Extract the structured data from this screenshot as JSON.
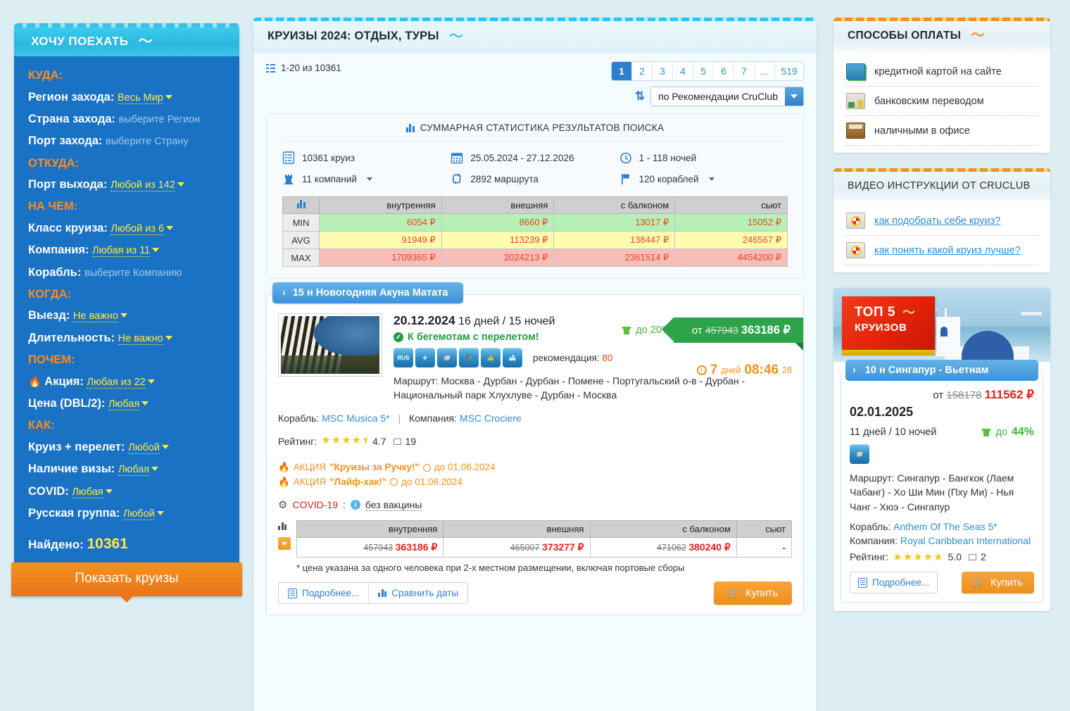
{
  "sidebar": {
    "title": "ХОЧУ ПОЕХАТЬ",
    "groups": {
      "where_to": "КУДА:",
      "where_from": "ОТКУДА:",
      "on_what": "НА ЧЕМ:",
      "when": "КОГДА:",
      "how_much": "ПОЧЕМ:",
      "how": "КАК:"
    },
    "fields": [
      {
        "label": "Регион захода:",
        "value": "Весь Мир",
        "dropdown": true
      },
      {
        "label": "Страна захода:",
        "value": "выберите Регион",
        "dropdown": false
      },
      {
        "label": "Порт захода:",
        "value": "выберите Страну",
        "dropdown": false
      },
      {
        "label": "Порт выхода:",
        "value": "Любой из 142",
        "dropdown": true
      },
      {
        "label": "Класс круиза:",
        "value": "Любой из 6",
        "dropdown": true
      },
      {
        "label": "Компания:",
        "value": "Любая из 11",
        "dropdown": true
      },
      {
        "label": "Корабль:",
        "value": "выберите Компанию",
        "dropdown": false
      },
      {
        "label": "Выезд:",
        "value": "Не важно",
        "dropdown": true
      },
      {
        "label": "Длительность:",
        "value": "Не важно",
        "dropdown": true
      },
      {
        "label": "Акция:",
        "value": "Любая из 22",
        "dropdown": true
      },
      {
        "label": "Цена (DBL/2):",
        "value": "Любая",
        "dropdown": true
      },
      {
        "label": "Круиз + перелет:",
        "value": "Любой",
        "dropdown": true
      },
      {
        "label": "Наличие визы:",
        "value": "Любая",
        "dropdown": true
      },
      {
        "label": "COVID:",
        "value": "Любая",
        "dropdown": true
      },
      {
        "label": "Русская группа:",
        "value": "Любой",
        "dropdown": true
      }
    ],
    "found_label": "Найдено:",
    "found_count": "10361",
    "show_button": "Показать круизы"
  },
  "main": {
    "title": "КРУИЗЫ 2024: ОТДЫХ, ТУРЫ",
    "results_count": "1-20 из 10361",
    "pagination": [
      "1",
      "2",
      "3",
      "4",
      "5",
      "6",
      "7",
      "...",
      "519"
    ],
    "active_page": "1",
    "sort_value": "по Рекомендации CruClub",
    "stats": {
      "title": "СУММАРНАЯ СТАТИСТИКА РЕЗУЛЬТАТОВ ПОИСКА",
      "items": [
        {
          "icon": "list-icon",
          "text": "10361 круиз",
          "dropdown": false
        },
        {
          "icon": "calendar-icon",
          "text": "25.05.2024 - 27.12.2026",
          "dropdown": false
        },
        {
          "icon": "clock-icon",
          "text": "1 - 118 ночей",
          "dropdown": false
        },
        {
          "icon": "rook-icon",
          "text": "11 компаний",
          "dropdown": true
        },
        {
          "icon": "route-icon",
          "text": "2892 маршрута",
          "dropdown": false
        },
        {
          "icon": "flag-icon",
          "text": "120 кораблей",
          "dropdown": true
        }
      ]
    },
    "card": {
      "tab_label": "15 н Новогодняя Акуна Матата",
      "date": "20.12.2024",
      "duration": "16 дней / 15 ночей",
      "promo_title": "К бегемотам с перелетом!",
      "feature_icons": [
        "rus-group-icon",
        "airplane-icon",
        "piggy-bank-icon",
        "family-wedding-icon",
        "thumbs-up-icon",
        "sofa-icon"
      ],
      "recommendation_label": "рекомендация:",
      "recommendation_value": "80",
      "discount_label": "до 20%",
      "price_prefix": "от",
      "price_old": "457943",
      "price_new": "363186 ₽",
      "timer_days": "7",
      "timer_days_label": "дней",
      "timer_time": "08:46",
      "timer_sec": "28",
      "route_label": "Маршрут:",
      "route": "Москва - Дурбан - Дурбан - Помене - Португальский о-в - Дурбан - Национальный парк Хлухлуве - Дурбан - Москва",
      "ship_label": "Корабль:",
      "ship": "MSC Musica 5*",
      "company_label": "Компания:",
      "company": "MSC Crociere",
      "rating_label": "Рейтинг:",
      "rating_value": "4.7",
      "rating_count": "19",
      "promos": [
        {
          "prefix": "АКЦИЯ",
          "name": "\"Круизы за Ручку!\"",
          "until": "до 01.06.2024"
        },
        {
          "prefix": "АКЦИЯ",
          "name": "\"Лайф-хак!\"",
          "until": "до 01.06.2024"
        }
      ],
      "covid_label": "COVID-19",
      "covid_value": "без вакцины",
      "cabin_headers": [
        "внутренняя",
        "внешняя",
        "с балконом",
        "сьют"
      ],
      "cabin_prices": [
        {
          "old": "457943",
          "new": "363186 ₽"
        },
        {
          "old": "465007",
          "new": "373277 ₽"
        },
        {
          "old": "471062",
          "new": "380240 ₽"
        },
        {
          "old": "",
          "new": "-"
        }
      ],
      "price_note": "* цена указана за одного человека при 2-х местном размещении, включая портовые сборы",
      "more_button": "Подробнее...",
      "compare_button": "Сравнить даты",
      "buy_button": "Купить"
    }
  },
  "payment_panel": {
    "title": "СПОСОБЫ ОПЛАТЫ",
    "items": [
      {
        "icon": "credit-card-icon",
        "label": "кредитной картой на сайте"
      },
      {
        "icon": "bank-transfer-icon",
        "label": "банковским переводом"
      },
      {
        "icon": "wallet-cash-icon",
        "label": "наличными в офисе"
      }
    ]
  },
  "video_panel": {
    "title": "ВИДЕО ИНСТРУКЦИИ ОТ CRUCLUB",
    "items": [
      {
        "icon": "lifebuoy-icon",
        "label": "как подобрать себе круиз?"
      },
      {
        "icon": "lifebuoy-icon",
        "label": "как понять какой круиз лучше?"
      }
    ]
  },
  "top5": {
    "banner_line1": "ТОП 5",
    "banner_line2": "КРУИЗОВ",
    "card": {
      "tab_label": "10 н Сингапур - Вьетнам",
      "price_prefix": "от",
      "price_old": "158178",
      "price_new": "111562 ₽",
      "date": "02.01.2025",
      "duration": "11 дней / 10 ночей",
      "discount_prefix": "до",
      "discount_value": "44%",
      "feature_icons": [
        "piggy-bank-icon"
      ],
      "route_label": "Маршрут:",
      "route": "Сингапур - Бангкок (Лаем Чабанг) - Хо Ши Мин (Пху Ми) - Нья Чанг - Хюэ - Сингапур",
      "ship_label": "Корабль:",
      "ship": "Anthem Of The Seas 5*",
      "company_label": "Компания:",
      "company": "Royal Caribbean International",
      "rating_label": "Рейтинг:",
      "rating_value": "5.0",
      "rating_count": "2",
      "more_button": "Подробнее...",
      "buy_button": "Купить"
    }
  },
  "chart_data": {
    "type": "table",
    "title": "СУММАРНАЯ СТАТИСТИКА РЕЗУЛЬТАТОВ ПОИСКА",
    "row_header_icon": "bar-chart-icon",
    "categories": [
      "внутренняя",
      "внешняя",
      "с балконом",
      "сьют"
    ],
    "rows": [
      {
        "name": "MIN",
        "values": [
          "6054 ₽",
          "8660 ₽",
          "13017 ₽",
          "15052 ₽"
        ],
        "color": "#b6f0b6"
      },
      {
        "name": "AVG",
        "values": [
          "91949 ₽",
          "113239 ₽",
          "138447 ₽",
          "246567 ₽"
        ],
        "color": "#fdfcb0"
      },
      {
        "name": "MAX",
        "values": [
          "1709365 ₽",
          "2024213 ₽",
          "2361514 ₽",
          "4454200 ₽"
        ],
        "color": "#f8bdb8"
      }
    ],
    "ylabel": "",
    "xlabel": "",
    "grid": true
  },
  "colors": {
    "page_bg": "#dceef4",
    "sidebar_blue": "#1a72c4",
    "accent_cyan": "#3ec4e4",
    "accent_orange": "#f0921e",
    "link_blue": "#2f8fd0",
    "price_red": "#e8201d",
    "green": "#2da34a",
    "yellow_value": "#ffe93d"
  }
}
